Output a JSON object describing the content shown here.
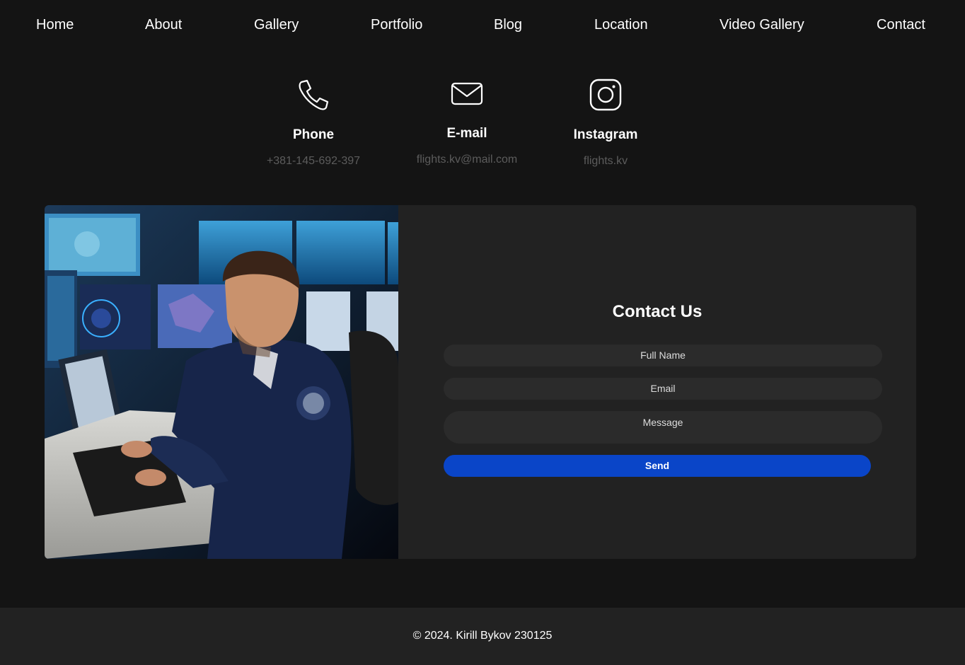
{
  "nav": {
    "items": [
      {
        "label": "Home"
      },
      {
        "label": "About"
      },
      {
        "label": "Gallery"
      },
      {
        "label": "Portfolio"
      },
      {
        "label": "Blog"
      },
      {
        "label": "Location"
      },
      {
        "label": "Video Gallery"
      },
      {
        "label": "Contact"
      }
    ]
  },
  "contacts": {
    "phone": {
      "title": "Phone",
      "value": "+381-145-692-397",
      "icon": "phone-icon"
    },
    "email": {
      "title": "E-mail",
      "value": "flights.kv@mail.com",
      "icon": "envelope-icon"
    },
    "instagram": {
      "title": "Instagram",
      "value": "flights.kv",
      "icon": "instagram-icon"
    }
  },
  "form": {
    "title": "Contact Us",
    "full_name_placeholder": "Full Name",
    "email_placeholder": "Email",
    "message_placeholder": "Message",
    "send_label": "Send"
  },
  "colors": {
    "background": "#141414",
    "panel": "#222222",
    "field": "#2b2b2b",
    "accent": "#0a45c8",
    "muted_text": "#5c5c5c"
  },
  "footer": {
    "copyright": "© 2024. Kirill Bykov 230125"
  }
}
